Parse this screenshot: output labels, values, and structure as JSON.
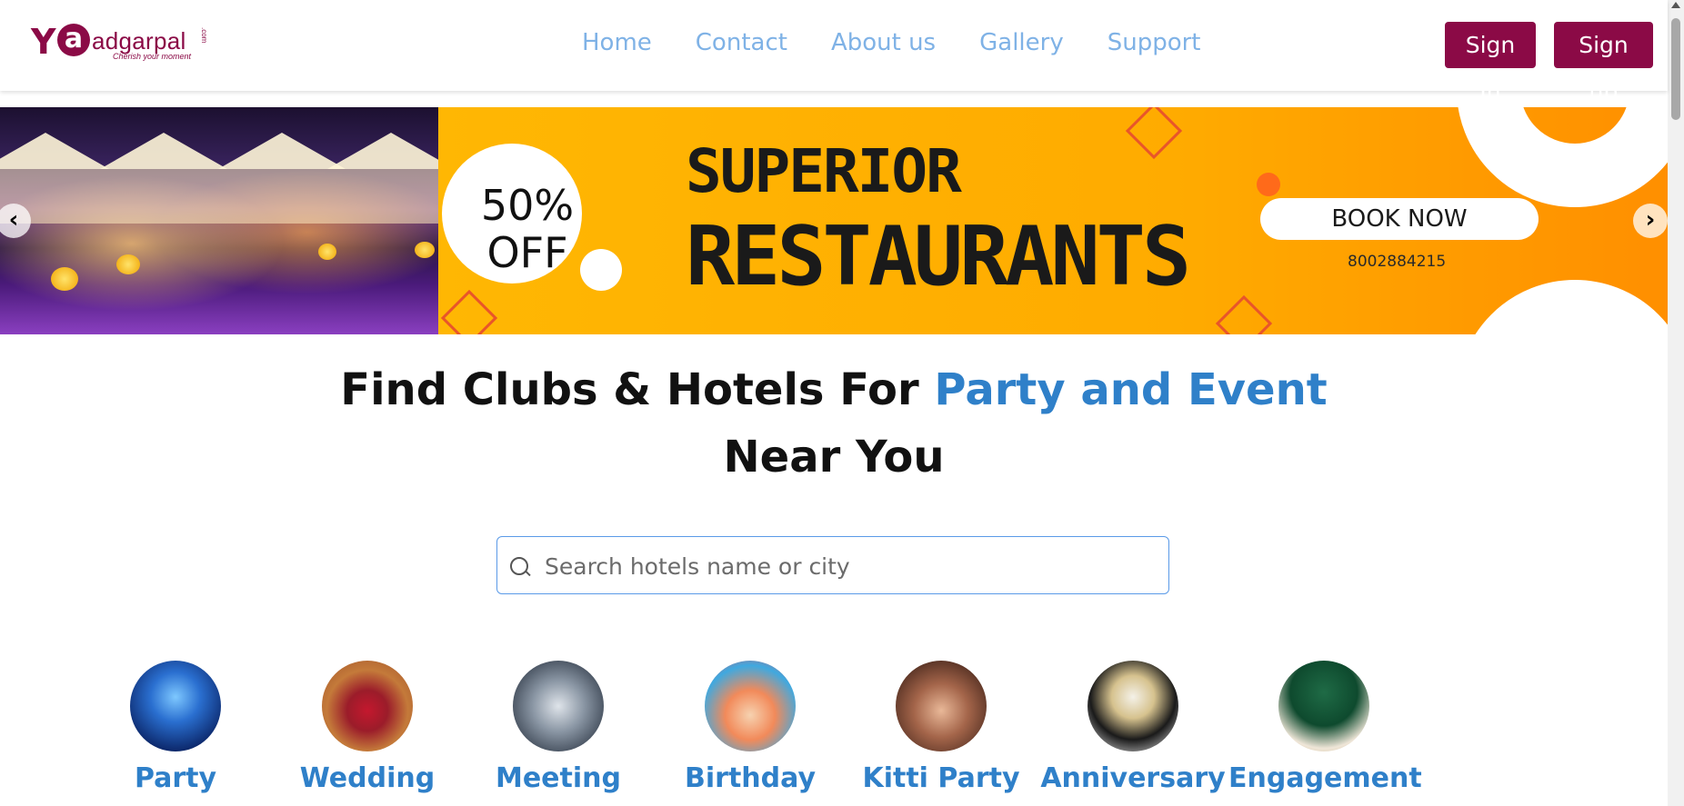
{
  "brand": {
    "logo_letter_y": "Y",
    "logo_letter_a": "a",
    "logo_rest": "adgarpal",
    "logo_dotcom": ".com",
    "tagline": "Cherish your moment",
    "color": "#8b0a46"
  },
  "nav": {
    "items": [
      {
        "label": "Home"
      },
      {
        "label": "Contact"
      },
      {
        "label": "About us"
      },
      {
        "label": "Gallery"
      },
      {
        "label": "Support"
      }
    ]
  },
  "auth": {
    "sign_in": "Sign In",
    "sign_up": "Sign up"
  },
  "banner": {
    "discount_line1": "50%",
    "discount_line2": "OFF",
    "headline_line1": "SUPERIOR",
    "headline_line2": "RESTAURANTS",
    "cta": "BOOK NOW",
    "phone": "8002884215",
    "prev_icon": "chevron-left-icon",
    "next_icon": "chevron-right-icon"
  },
  "hero": {
    "title_part1": "Find Clubs & Hotels For ",
    "title_accent": "Party and Event",
    "title_line2": "Near You",
    "accent_color": "#2f80c9"
  },
  "search": {
    "placeholder": "Search hotels name or city",
    "value": "",
    "icon": "search-icon"
  },
  "categories": [
    {
      "label": "Party",
      "icon": "party-image"
    },
    {
      "label": "Wedding",
      "icon": "wedding-image"
    },
    {
      "label": "Meeting",
      "icon": "meeting-image"
    },
    {
      "label": "Birthday",
      "icon": "birthday-image"
    },
    {
      "label": "Kitti Party",
      "icon": "kitti-party-image"
    },
    {
      "label": "Anniversary",
      "icon": "anniversary-image"
    },
    {
      "label": "Engagement",
      "icon": "engagement-image"
    }
  ]
}
